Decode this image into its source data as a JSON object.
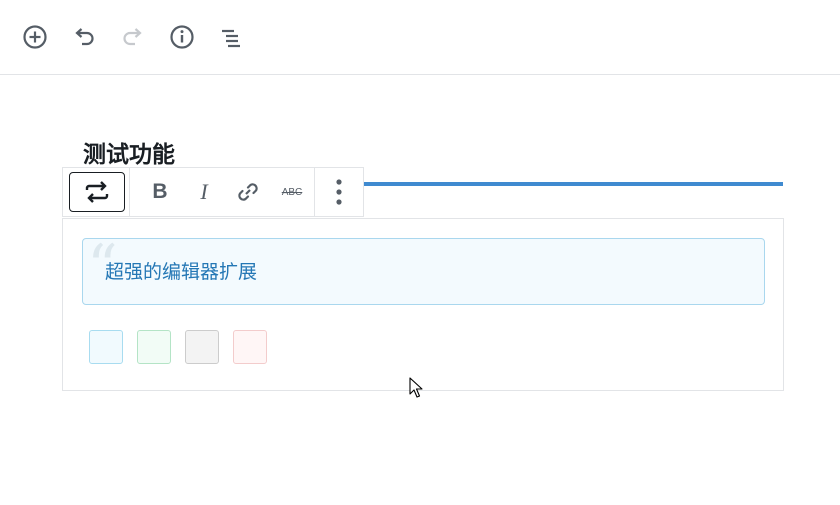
{
  "topbar": {
    "buttons": [
      {
        "icon": "plus-circle-icon",
        "enabled": true
      },
      {
        "icon": "undo-icon",
        "enabled": true
      },
      {
        "icon": "redo-icon",
        "enabled": false
      },
      {
        "icon": "info-icon",
        "enabled": true
      },
      {
        "icon": "list-view-icon",
        "enabled": true
      }
    ]
  },
  "editor": {
    "heading": "测试功能",
    "accent_color": "#3f8ad0"
  },
  "block_toolbar": {
    "switcher_icon": "block-switcher-icon",
    "bold_label": "B",
    "italic_label": "I",
    "link_icon": "link-icon",
    "strikethrough_label": "ABC",
    "more_icon": "more-vertical-icon"
  },
  "quote_block": {
    "text": "超强的编辑器扩展",
    "background": "#f3fafe",
    "border": "#a9d7ee",
    "text_color": "#2477b5",
    "style_swatches": [
      {
        "name": "info",
        "bg": "#f1fafe",
        "border": "#a8dcf0"
      },
      {
        "name": "success",
        "bg": "#f2fcf6",
        "border": "#b4e4c6"
      },
      {
        "name": "neutral",
        "bg": "#f3f3f3",
        "border": "#cccccc"
      },
      {
        "name": "danger",
        "bg": "#fff6f6",
        "border": "#f3cccc"
      }
    ]
  }
}
